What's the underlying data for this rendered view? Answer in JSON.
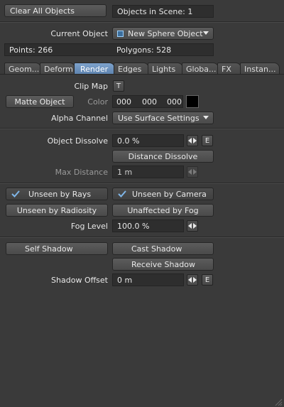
{
  "top": {
    "clear_all_label": "Clear All Objects",
    "objects_in_scene": "Objects in Scene: 1"
  },
  "object": {
    "current_object_label": "Current Object",
    "current_object_value": "New Sphere Object",
    "points": "Points: 266",
    "polygons": "Polygons: 528"
  },
  "tabs": [
    {
      "label": "Geom..."
    },
    {
      "label": "Deform"
    },
    {
      "label": "Render"
    },
    {
      "label": "Edges"
    },
    {
      "label": "Lights"
    },
    {
      "label": "Globa..."
    },
    {
      "label": "FX"
    },
    {
      "label": "Instan..."
    }
  ],
  "render": {
    "clip_map_label": "Clip Map",
    "clip_map_button": "T",
    "matte_object_label": "Matte Object",
    "color_label": "Color",
    "color_r": "000",
    "color_g": "000",
    "color_b": "000",
    "swatch_color": "#000000",
    "alpha_channel_label": "Alpha Channel",
    "alpha_channel_value": "Use Surface Settings",
    "object_dissolve_label": "Object Dissolve",
    "object_dissolve_value": "0.0 %",
    "env_button": "E",
    "distance_dissolve_label": "Distance Dissolve",
    "max_distance_label": "Max Distance",
    "max_distance_value": "1 m",
    "unseen_by_rays": "Unseen by Rays",
    "unseen_by_camera": "Unseen by Camera",
    "unseen_by_radiosity": "Unseen by Radiosity",
    "unaffected_by_fog": "Unaffected by Fog",
    "fog_level_label": "Fog Level",
    "fog_level_value": "100.0 %",
    "self_shadow": "Self Shadow",
    "cast_shadow": "Cast Shadow",
    "receive_shadow": "Receive Shadow",
    "shadow_offset_label": "Shadow Offset",
    "shadow_offset_value": "0 m",
    "shadow_env_button": "E"
  },
  "colors": {
    "panel_bg": "#3a3a3a",
    "active_tab": "#6d92bd",
    "check_blue": "#7fb6e8"
  }
}
